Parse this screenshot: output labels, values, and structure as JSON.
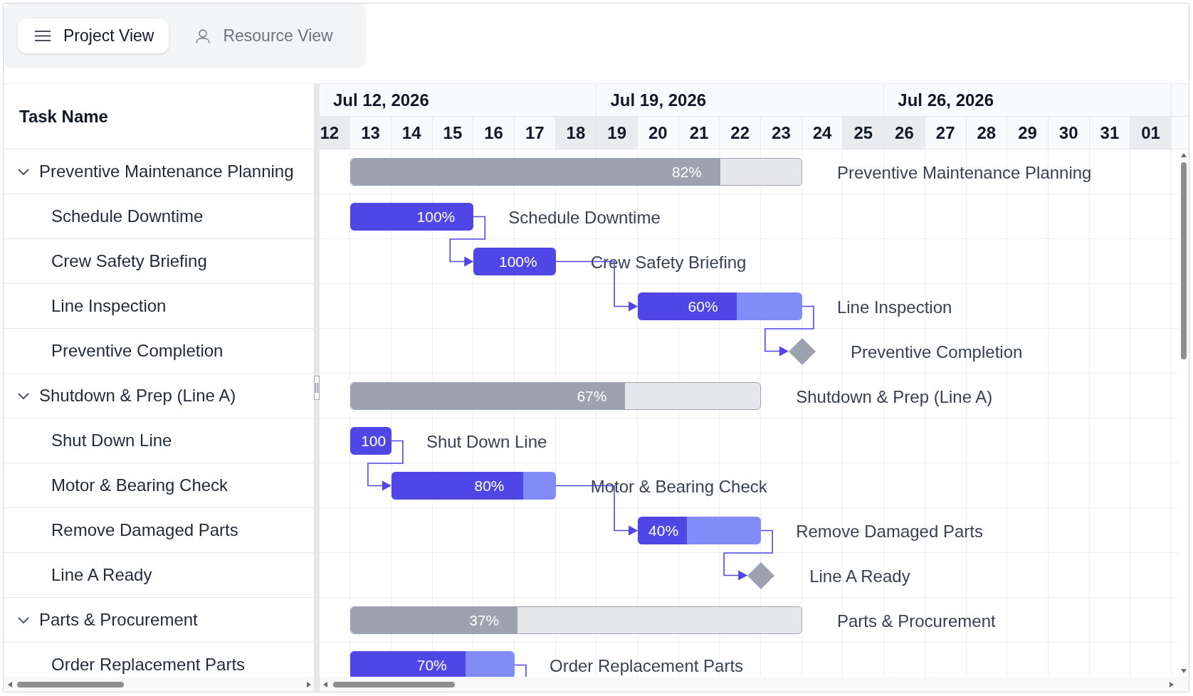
{
  "view_tabs": [
    {
      "label": "Project View",
      "selected": true
    },
    {
      "label": "Resource View",
      "selected": false
    }
  ],
  "gantt": {
    "column_header": "Task Name",
    "timeline": {
      "weeks": [
        "Jul 12, 2026",
        "Jul 19, 2026",
        "Jul 26, 2026"
      ],
      "days": [
        {
          "label": "12",
          "weekend": true
        },
        {
          "label": "13",
          "weekend": false
        },
        {
          "label": "14",
          "weekend": false
        },
        {
          "label": "15",
          "weekend": false
        },
        {
          "label": "16",
          "weekend": false
        },
        {
          "label": "17",
          "weekend": false
        },
        {
          "label": "18",
          "weekend": true
        },
        {
          "label": "19",
          "weekend": true
        },
        {
          "label": "20",
          "weekend": false
        },
        {
          "label": "21",
          "weekend": false
        },
        {
          "label": "22",
          "weekend": false
        },
        {
          "label": "23",
          "weekend": false
        },
        {
          "label": "24",
          "weekend": false
        },
        {
          "label": "25",
          "weekend": true
        },
        {
          "label": "26",
          "weekend": true
        },
        {
          "label": "27",
          "weekend": false
        },
        {
          "label": "28",
          "weekend": false
        },
        {
          "label": "29",
          "weekend": false
        },
        {
          "label": "30",
          "weekend": false
        },
        {
          "label": "31",
          "weekend": false
        },
        {
          "label": "01",
          "weekend": true
        }
      ]
    },
    "tasks": [
      {
        "kind": "group",
        "name": "Preventive Maintenance Planning",
        "expanded": true,
        "level": 0.82,
        "progress_label": "82%",
        "bar_label": "Preventive Maintenance Planning",
        "link_to_next": false,
        "children": [
          {
            "kind": "task",
            "name": "Schedule Downtime",
            "level": 1,
            "progress_label": "100%",
            "bar_label": "Schedule Downtime",
            "link_to_next": true
          },
          {
            "kind": "task",
            "name": "Crew Safety Briefing",
            "level": 1,
            "progress_label": "100%",
            "bar_label": "Crew Safety Briefing",
            "link_to_next": true
          },
          {
            "kind": "task",
            "name": "Line Inspection",
            "level": 0.6,
            "progress_label": "60%",
            "bar_label": "Line Inspection",
            "link_to_next": true
          },
          {
            "kind": "milestone",
            "name": "Preventive Completion",
            "bar_label": "Preventive Completion",
            "link_to_next": false
          }
        ]
      },
      {
        "kind": "group",
        "name": "Shutdown & Prep (Line A)",
        "expanded": true,
        "level": 0.67,
        "progress_label": "67%",
        "bar_label": "Shutdown & Prep (Line A)",
        "link_to_next": false,
        "children": [
          {
            "kind": "task",
            "name": "Shut Down Line",
            "level": 1,
            "progress_label": "100",
            "bar_label": "Shut Down Line",
            "link_to_next": true
          },
          {
            "kind": "task",
            "name": "Motor & Bearing Check",
            "level": 0.8,
            "progress_label": "80%",
            "bar_label": "Motor & Bearing Check",
            "link_to_next": true
          },
          {
            "kind": "task",
            "name": "Remove Damaged Parts",
            "level": 0.4,
            "progress_label": "40%",
            "bar_label": "Remove Damaged Parts",
            "link_to_next": true
          },
          {
            "kind": "milestone",
            "name": "Line A Ready",
            "bar_label": "Line A Ready",
            "link_to_next": false
          }
        ]
      },
      {
        "kind": "group",
        "name": "Parts & Procurement",
        "expanded": true,
        "level": 0.37,
        "progress_label": "37%",
        "bar_label": "Parts & Procurement",
        "link_to_next": false,
        "children": [
          {
            "kind": "task",
            "name": "Order Replacement Parts",
            "level": 0.7,
            "progress_label": "70%",
            "bar_label": "Order Replacement Parts",
            "link_to_next": true
          }
        ]
      }
    ]
  }
}
